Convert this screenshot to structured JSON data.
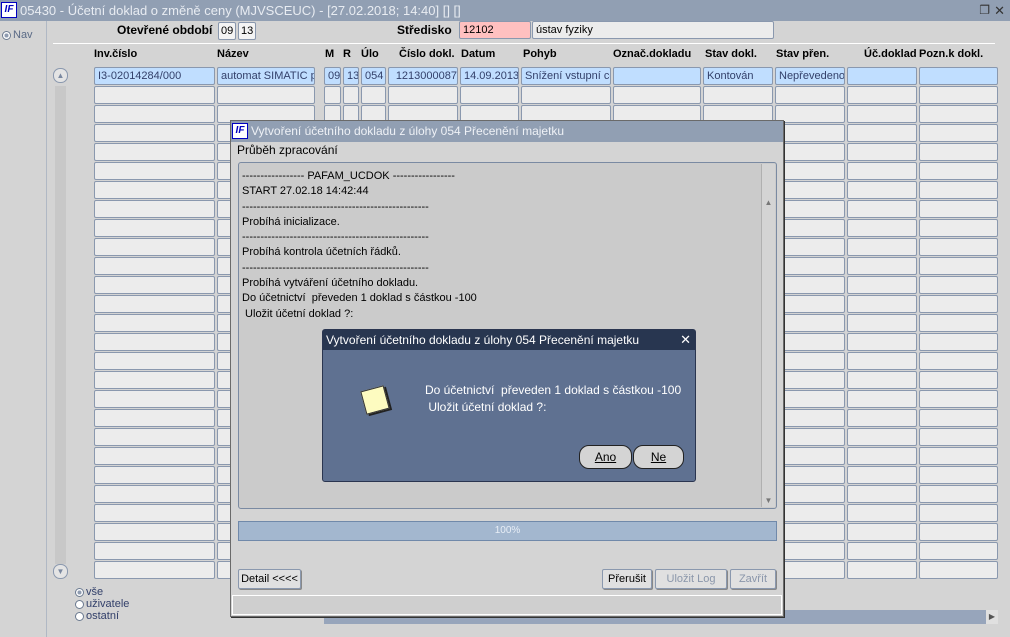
{
  "window": {
    "title": "05430 - Účetní doklad o změně ceny (MJVSCEUC) - [27.02.2018; 14:40]  [] []",
    "logo": "IF"
  },
  "nav": {
    "label": "Nav"
  },
  "header": {
    "period_label": "Otevřené období",
    "period_month": "09",
    "period_year": "13",
    "center_label": "Středisko",
    "center_code": "12102",
    "center_name": "ústav fyziky"
  },
  "table": {
    "columns": [
      "Inv.číslo",
      "Název",
      "M",
      "R",
      "Úlo",
      "Číslo dokl.",
      "Datum",
      "Pohyb",
      "Označ.dokladu",
      "Stav dokl.",
      "Stav přen.",
      "Úč.doklad",
      "Pozn.k dokl."
    ],
    "rows": [
      [
        "I3-02014284/000",
        "automat SIMATIC pr",
        "09",
        "13",
        "054",
        "1213000087",
        "14.09.2013",
        "Snížení vstupní ce",
        "",
        "Kontován",
        "Nepřevedeno",
        "",
        ""
      ]
    ]
  },
  "filter": {
    "options": [
      "vše",
      "uživatele",
      "ostatní"
    ],
    "selected": "vše"
  },
  "dialog": {
    "title": "Vytvoření účetního dokladu z úlohy 054 Přecenění majetku",
    "section": "Průběh zpracování",
    "log": [
      "----------------- PAFAM_UCDOK -----------------",
      "START 27.02.18 14:42:44",
      "---------------------------------------------------",
      "Probíhá inicializace.",
      "---------------------------------------------------",
      "Probíhá kontrola účetních řádků.",
      "---------------------------------------------------",
      "Probíhá vytváření účetního dokladu.",
      "Do účetnictví  převeden 1 doklad s částkou -100",
      " Uložit účetní doklad ?:"
    ],
    "progress_percent": 100,
    "progress_label": "100%",
    "detail_button": "Detail <<<<",
    "abort_button": "Přerušit",
    "save_log_button": "Uložit Log",
    "close_button": "Zavřít"
  },
  "message": {
    "title": "Vytvoření účetního dokladu z úlohy 054 Přecenění majetku",
    "text": "Do účetnictví  převeden 1 doklad s částkou -100\n Uložit účetní doklad ?:",
    "yes": "Ano",
    "no": "Ne"
  }
}
